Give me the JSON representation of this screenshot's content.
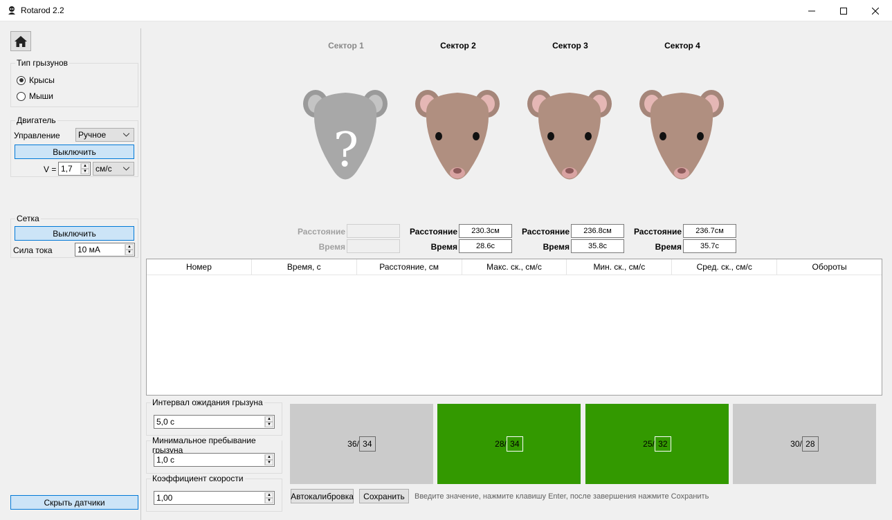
{
  "window": {
    "title": "Rotarod 2.2"
  },
  "rodent_type": {
    "title": "Тип грызунов",
    "options": [
      {
        "label": "Крысы",
        "checked": true
      },
      {
        "label": "Мыши",
        "checked": false
      }
    ]
  },
  "motor": {
    "title": "Двигатель",
    "control_label": "Управление",
    "control_value": "Ручное",
    "toggle_label": "Выключить",
    "speed_label": "V =",
    "speed_value": "1,7",
    "speed_unit": "см/с"
  },
  "grid": {
    "title": "Сетка",
    "toggle_label": "Выключить",
    "current_label": "Сила тока",
    "current_value": "10 мА"
  },
  "hide_sensors_label": "Скрыть датчики",
  "sectors": [
    {
      "name": "Сектор 1",
      "active": false,
      "distance_label": "Расстояние",
      "time_label": "Время",
      "distance": "",
      "time": ""
    },
    {
      "name": "Сектор 2",
      "active": true,
      "distance_label": "Расстояние",
      "time_label": "Время",
      "distance": "230.3см",
      "time": "28.6с"
    },
    {
      "name": "Сектор 3",
      "active": true,
      "distance_label": "Расстояние",
      "time_label": "Время",
      "distance": "236.8см",
      "time": "35.8с"
    },
    {
      "name": "Сектор 4",
      "active": true,
      "distance_label": "Расстояние",
      "time_label": "Время",
      "distance": "236.7см",
      "time": "35.7с"
    }
  ],
  "table": {
    "columns": [
      "Номер",
      "Время, с",
      "Расстояние, см",
      "Макс. ск., см/с",
      "Мин. ск., см/с",
      "Сред. ск., см/с",
      "Обороты"
    ],
    "rows": []
  },
  "settings": [
    {
      "label": "Интервал ожидания грызуна",
      "value": "5,0 с"
    },
    {
      "label": "Минимальное пребывание грызуна",
      "value": "1,0 с"
    },
    {
      "label": "Коэффициент скорости",
      "value": "1,00"
    }
  ],
  "sensors": [
    {
      "current": "36/",
      "threshold": "34",
      "state": "gray",
      "color": "#cbcbcb"
    },
    {
      "current": "28/",
      "threshold": "34",
      "state": "green",
      "color": "#339900"
    },
    {
      "current": "25/",
      "threshold": "32",
      "state": "green",
      "color": "#339900"
    },
    {
      "current": "30/",
      "threshold": "28",
      "state": "gray",
      "color": "#cbcbcb"
    }
  ],
  "actions": {
    "autocalibrate": "Автокалибровка",
    "save": "Сохранить",
    "hint": "Введите значение, нажмите клавишу Enter, после завершения нажмите Сохранить"
  }
}
